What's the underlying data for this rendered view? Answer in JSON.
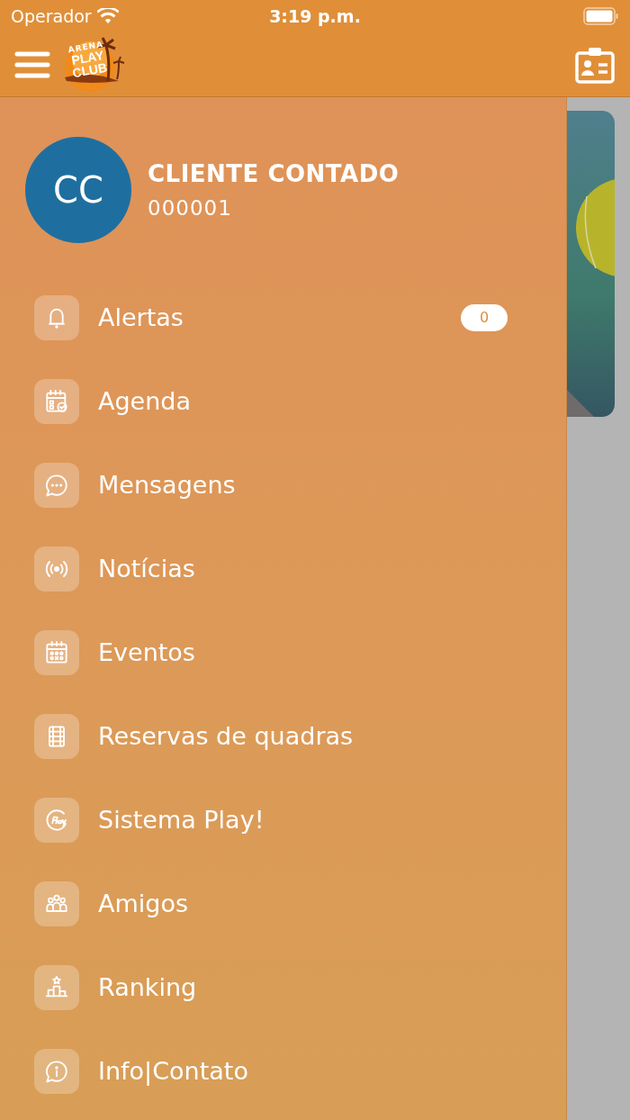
{
  "status_bar": {
    "carrier": "Operador",
    "time": "3:19 p.m."
  },
  "header": {
    "logo": {
      "top": "ARENA",
      "line1": "PLAY",
      "line2": "CLUB"
    }
  },
  "profile": {
    "initials": "CC",
    "name": "CLIENTE CONTADO",
    "code": "000001"
  },
  "menu": [
    {
      "kind": "bell",
      "label": "Alertas",
      "badge": "0"
    },
    {
      "kind": "agenda",
      "label": "Agenda"
    },
    {
      "kind": "chat",
      "label": "Mensagens"
    },
    {
      "kind": "broadcast",
      "label": "Notícias"
    },
    {
      "kind": "calendar",
      "label": "Eventos"
    },
    {
      "kind": "court",
      "label": "Reservas de quadras"
    },
    {
      "kind": "play",
      "label": "Sistema Play!"
    },
    {
      "kind": "group",
      "label": "Amigos"
    },
    {
      "kind": "podium",
      "label": "Ranking"
    },
    {
      "kind": "info",
      "label": "Info|Contato"
    }
  ]
}
